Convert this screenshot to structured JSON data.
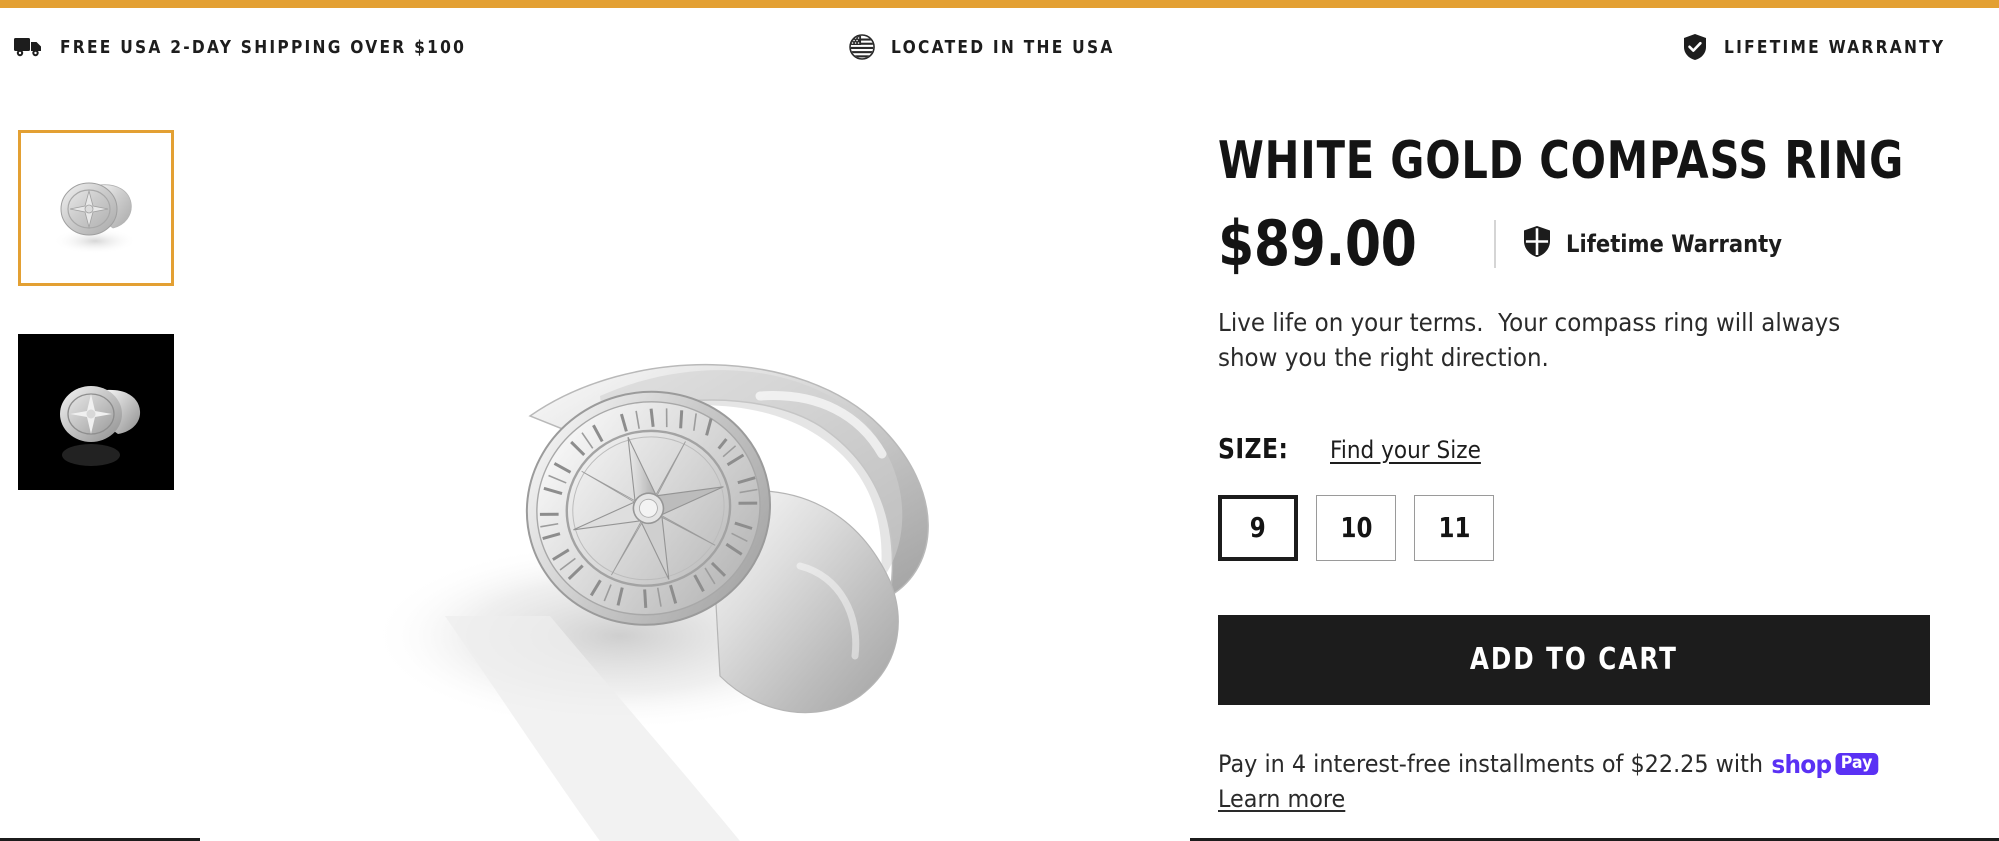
{
  "theme": {
    "accent_orange": "#E3A033",
    "ink": "#1C1C1C",
    "shoppay_purple": "#5A31F4"
  },
  "announcement_bar": {
    "items": [
      {
        "icon": "delivery-truck-icon",
        "text": "FREE USA 2-DAY SHIPPING OVER $100"
      },
      {
        "icon": "usa-flag-circle-icon",
        "text": "LOCATED IN THE USA"
      },
      {
        "icon": "shield-check-icon",
        "text": "LIFETIME WARRANTY"
      }
    ]
  },
  "gallery": {
    "thumbnails": [
      {
        "name": "white-gold-compass-ring-white-background",
        "selected": true,
        "background": "white"
      },
      {
        "name": "white-gold-compass-ring-black-background",
        "selected": false,
        "background": "black"
      }
    ],
    "main_image_alt": "White Gold Compass Ring on white background"
  },
  "product": {
    "title": "WHITE GOLD COMPASS RING",
    "price": "$89.00",
    "warranty_badge": "Lifetime Warranty",
    "description": "Live life on your terms.  Your compass ring will always show you the right direction."
  },
  "size_selector": {
    "label": "SIZE:",
    "size_guide_link": "Find your Size",
    "options": [
      {
        "value": "9",
        "selected": true
      },
      {
        "value": "10",
        "selected": false
      },
      {
        "value": "11",
        "selected": false
      }
    ]
  },
  "actions": {
    "add_to_cart": "ADD TO CART"
  },
  "installments": {
    "text_before": "Pay in 4 interest-free installments of $22.25 with",
    "provider_word": "shop",
    "provider_badge": "Pay",
    "learn_more": "Learn more"
  }
}
